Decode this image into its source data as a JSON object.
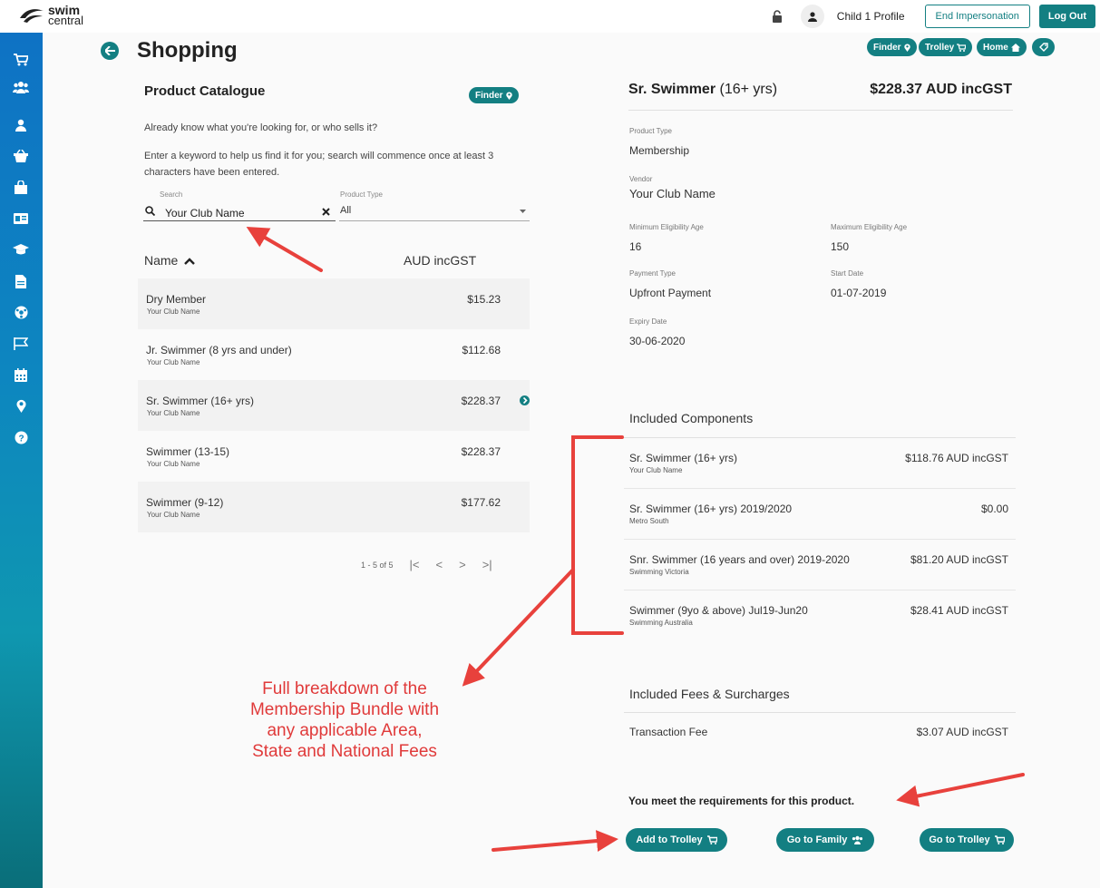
{
  "header": {
    "logo_line1": "swim",
    "logo_line2": "central",
    "profile_label": "Child 1 Profile",
    "end_impersonation_label": "End Impersonation",
    "logout_label": "Log Out"
  },
  "page": {
    "title": "Shopping",
    "pills": {
      "finder": "Finder",
      "trolley": "Trolley",
      "home": "Home"
    }
  },
  "catalogue": {
    "title": "Product Catalogue",
    "finder_label": "Finder",
    "intro_text": "Already know what you're looking for, or who sells it?",
    "help_line1": "Enter a keyword to help us find it for you; search will commence once at least 3",
    "help_line2": "characters have been entered.",
    "search_label": "Search",
    "search_value": "Your Club Name",
    "product_type_label": "Product Type",
    "product_type_value": "All",
    "col_name": "Name",
    "col_price": "AUD incGST",
    "rows": [
      {
        "name": "Dry Member",
        "vendor": "Your Club Name",
        "price": "$15.23"
      },
      {
        "name": "Jr. Swimmer (8 yrs and under)",
        "vendor": "Your Club Name",
        "price": "$112.68"
      },
      {
        "name": "Sr. Swimmer (16+ yrs)",
        "vendor": "Your Club Name",
        "price": "$228.37"
      },
      {
        "name": "Swimmer (13-15)",
        "vendor": "Your Club Name",
        "price": "$228.37"
      },
      {
        "name": "Swimmer (9-12)",
        "vendor": "Your Club Name",
        "price": "$177.62"
      }
    ],
    "pager_text": "1 - 5 of 5"
  },
  "detail": {
    "title": "Sr. Swimmer",
    "title_suffix": "(16+ yrs)",
    "price": "$228.37 AUD incGST",
    "product_type_label": "Product Type",
    "product_type": "Membership",
    "vendor_label": "Vendor",
    "vendor": "Your Club Name",
    "min_age_label": "Minimum Eligibility Age",
    "min_age": "16",
    "max_age_label": "Maximum Eligibility Age",
    "max_age": "150",
    "payment_type_label": "Payment Type",
    "payment_type": "Upfront Payment",
    "start_date_label": "Start Date",
    "start_date": "01-07-2019",
    "expiry_date_label": "Expiry Date",
    "expiry_date": "30-06-2020",
    "components_title": "Included Components",
    "components": [
      {
        "name": "Sr. Swimmer (16+ yrs)",
        "vendor": "Your Club Name",
        "price": "$118.76 AUD incGST"
      },
      {
        "name": "Sr. Swimmer (16+ yrs) 2019/2020",
        "vendor": "Metro South",
        "price": "$0.00"
      },
      {
        "name": "Snr. Swimmer (16 years and over) 2019-2020",
        "vendor": "Swimming Victoria",
        "price": "$81.20 AUD incGST"
      },
      {
        "name": "Swimmer (9yo & above) Jul19-Jun20",
        "vendor": "Swimming Australia",
        "price": "$28.41 AUD incGST"
      }
    ],
    "fees_title": "Included Fees & Surcharges",
    "fees": [
      {
        "name": "Transaction Fee",
        "price": "$3.07 AUD incGST"
      }
    ],
    "requirement_text": "You meet the requirements for this product.",
    "add_to_trolley": "Add to Trolley",
    "go_to_family": "Go to Family",
    "go_to_trolley": "Go to Trolley"
  },
  "annotation": {
    "line1": "Full breakdown of the",
    "line2": "Membership Bundle with",
    "line3": "any applicable Area,",
    "line4": "State and National Fees"
  },
  "colors": {
    "accent": "#137f82",
    "annotation": "#e03a3a"
  }
}
